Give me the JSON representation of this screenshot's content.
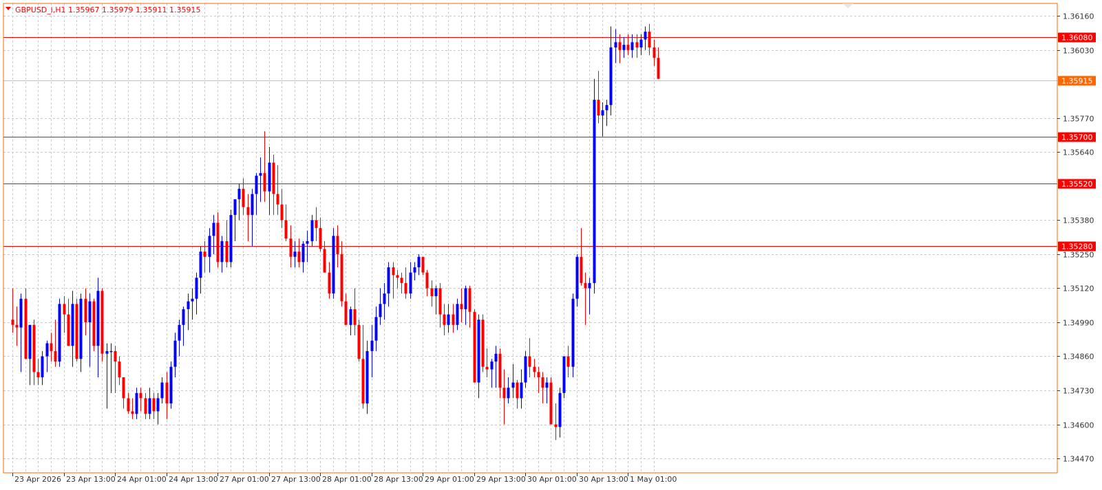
{
  "chart_data": {
    "type": "candlestick",
    "symbol": "GBPUSD_i,H1",
    "ohlc_header": {
      "open": "1.35967",
      "high": "1.35979",
      "low": "1.35911",
      "close": "1.35915"
    },
    "title": "GBPUSD_i,H1  1.35967 1.35979 1.35911 1.35915",
    "y_ticks": [
      "1.36160",
      "1.36030",
      "1.35770",
      "1.35640",
      "1.35380",
      "1.35250",
      "1.35120",
      "1.34990",
      "1.34860",
      "1.34730",
      "1.34600",
      "1.34470"
    ],
    "ylim": [
      1.34415,
      1.36208
    ],
    "x_ticks": [
      {
        "label": "23 Apr 2026",
        "bar": 0
      },
      {
        "label": "23 Apr 13:00",
        "bar": 12
      },
      {
        "label": "24 Apr 01:00",
        "bar": 24
      },
      {
        "label": "24 Apr 13:00",
        "bar": 36
      },
      {
        "label": "27 Apr 01:00",
        "bar": 48
      },
      {
        "label": "27 Apr 13:00",
        "bar": 60
      },
      {
        "label": "28 Apr 01:00",
        "bar": 72
      },
      {
        "label": "28 Apr 13:00",
        "bar": 84
      },
      {
        "label": "29 Apr 01:00",
        "bar": 96
      },
      {
        "label": "29 Apr 13:00",
        "bar": 108
      },
      {
        "label": "30 Apr 01:00",
        "bar": 120
      },
      {
        "label": "30 Apr 13:00",
        "bar": 132
      },
      {
        "label": "1 May 01:00",
        "bar": 144
      }
    ],
    "levels": [
      {
        "price": 1.3608,
        "label": "1.36080",
        "color": "#ff0000"
      },
      {
        "price": 1.357,
        "label": "1.35700",
        "color": "#ff0000"
      },
      {
        "price": 1.3552,
        "label": "1.35520",
        "color": "#ff0000"
      },
      {
        "price": 1.3528,
        "label": "1.35280",
        "color": "#ff0000"
      }
    ],
    "current_price": {
      "price": 1.35915,
      "label": "1.35915",
      "color": "#ff6600"
    },
    "bull_color": "#0000ff",
    "bear_color": "#ff0000",
    "candles": [
      [
        1.35,
        1.3512,
        1.3495,
        1.3498
      ],
      [
        1.3498,
        1.3505,
        1.349,
        1.3497
      ],
      [
        1.3497,
        1.351,
        1.348,
        1.3508
      ],
      [
        1.3508,
        1.3512,
        1.3485,
        1.3485
      ],
      [
        1.3485,
        1.3498,
        1.3475,
        1.3498
      ],
      [
        1.3498,
        1.35,
        1.3475,
        1.348
      ],
      [
        1.348,
        1.3485,
        1.3475,
        1.3478
      ],
      [
        1.3478,
        1.3488,
        1.3475,
        1.3486
      ],
      [
        1.3486,
        1.3492,
        1.348,
        1.3491
      ],
      [
        1.3491,
        1.3495,
        1.3484,
        1.3488
      ],
      [
        1.3488,
        1.35,
        1.3482,
        1.3484
      ],
      [
        1.3484,
        1.3508,
        1.3482,
        1.3506
      ],
      [
        1.3506,
        1.3509,
        1.3495,
        1.3502
      ],
      [
        1.3502,
        1.3508,
        1.349,
        1.349
      ],
      [
        1.349,
        1.3511,
        1.3482,
        1.3506
      ],
      [
        1.3506,
        1.3508,
        1.3484,
        1.3485
      ],
      [
        1.3485,
        1.351,
        1.348,
        1.3508
      ],
      [
        1.3508,
        1.3512,
        1.3494,
        1.3499
      ],
      [
        1.3499,
        1.351,
        1.3482,
        1.3507
      ],
      [
        1.3507,
        1.3508,
        1.3488,
        1.349
      ],
      [
        1.349,
        1.3516,
        1.3478,
        1.3511
      ],
      [
        1.3511,
        1.3512,
        1.3484,
        1.3487
      ],
      [
        1.3487,
        1.3491,
        1.3466,
        1.3488
      ],
      [
        1.3488,
        1.3491,
        1.3472,
        1.3488
      ],
      [
        1.3488,
        1.349,
        1.3472,
        1.3484
      ],
      [
        1.3484,
        1.3486,
        1.3475,
        1.3478
      ],
      [
        1.3478,
        1.3478,
        1.3466,
        1.347
      ],
      [
        1.347,
        1.3472,
        1.3464,
        1.3465
      ],
      [
        1.3465,
        1.347,
        1.3462,
        1.3464
      ],
      [
        1.3464,
        1.3474,
        1.3462,
        1.3472
      ],
      [
        1.3472,
        1.3474,
        1.3465,
        1.347
      ],
      [
        1.347,
        1.3472,
        1.3462,
        1.3464
      ],
      [
        1.3464,
        1.3474,
        1.3462,
        1.347
      ],
      [
        1.347,
        1.3472,
        1.3462,
        1.3465
      ],
      [
        1.3465,
        1.3472,
        1.346,
        1.347
      ],
      [
        1.347,
        1.3478,
        1.3468,
        1.3476
      ],
      [
        1.3476,
        1.348,
        1.3462,
        1.3468
      ],
      [
        1.3468,
        1.3484,
        1.3466,
        1.3482
      ],
      [
        1.3482,
        1.3495,
        1.3478,
        1.3492
      ],
      [
        1.3492,
        1.35,
        1.3486,
        1.3498
      ],
      [
        1.3498,
        1.3505,
        1.349,
        1.3504
      ],
      [
        1.3504,
        1.351,
        1.3496,
        1.3507
      ],
      [
        1.3507,
        1.3512,
        1.35,
        1.3508
      ],
      [
        1.3508,
        1.3518,
        1.3502,
        1.3516
      ],
      [
        1.3516,
        1.3528,
        1.351,
        1.3526
      ],
      [
        1.3526,
        1.353,
        1.3518,
        1.3524
      ],
      [
        1.3524,
        1.3535,
        1.3518,
        1.3532
      ],
      [
        1.3532,
        1.354,
        1.3525,
        1.3537
      ],
      [
        1.3537,
        1.3541,
        1.352,
        1.3522
      ],
      [
        1.3522,
        1.3532,
        1.3518,
        1.353
      ],
      [
        1.353,
        1.3538,
        1.352,
        1.3522
      ],
      [
        1.3522,
        1.3542,
        1.352,
        1.354
      ],
      [
        1.354,
        1.3545,
        1.353,
        1.3546
      ],
      [
        1.3546,
        1.3552,
        1.3538,
        1.355
      ],
      [
        1.355,
        1.3554,
        1.354,
        1.3543
      ],
      [
        1.3543,
        1.3548,
        1.353,
        1.354
      ],
      [
        1.354,
        1.355,
        1.3528,
        1.3548
      ],
      [
        1.3548,
        1.3556,
        1.354,
        1.3555
      ],
      [
        1.3555,
        1.3562,
        1.3545,
        1.3556
      ],
      [
        1.3556,
        1.3572,
        1.3545,
        1.3549
      ],
      [
        1.3549,
        1.3566,
        1.354,
        1.356
      ],
      [
        1.356,
        1.3563,
        1.354,
        1.3548
      ],
      [
        1.3548,
        1.3559,
        1.354,
        1.3544
      ],
      [
        1.3544,
        1.355,
        1.3535,
        1.3538
      ],
      [
        1.3538,
        1.3544,
        1.353,
        1.3531
      ],
      [
        1.3531,
        1.3536,
        1.352,
        1.3524
      ],
      [
        1.3524,
        1.353,
        1.352,
        1.3526
      ],
      [
        1.3526,
        1.3531,
        1.352,
        1.3522
      ],
      [
        1.3522,
        1.353,
        1.3518,
        1.3529
      ],
      [
        1.3529,
        1.3534,
        1.3522,
        1.353
      ],
      [
        1.353,
        1.354,
        1.3528,
        1.3538
      ],
      [
        1.3538,
        1.3543,
        1.353,
        1.3535
      ],
      [
        1.3535,
        1.3539,
        1.3526,
        1.3527
      ],
      [
        1.3527,
        1.353,
        1.3518,
        1.3518
      ],
      [
        1.3518,
        1.3522,
        1.3508,
        1.351
      ],
      [
        1.351,
        1.3535,
        1.3508,
        1.3532
      ],
      [
        1.3532,
        1.3536,
        1.352,
        1.3525
      ],
      [
        1.3525,
        1.353,
        1.3505,
        1.3507
      ],
      [
        1.3507,
        1.351,
        1.3498,
        1.3498
      ],
      [
        1.3498,
        1.3505,
        1.3494,
        1.3504
      ],
      [
        1.3504,
        1.3512,
        1.3494,
        1.3498
      ],
      [
        1.3498,
        1.35,
        1.3484,
        1.3485
      ],
      [
        1.3485,
        1.3498,
        1.3466,
        1.3468
      ],
      [
        1.3468,
        1.3492,
        1.3464,
        1.3488
      ],
      [
        1.3488,
        1.3498,
        1.3478,
        1.3492
      ],
      [
        1.3492,
        1.3505,
        1.3488,
        1.3501
      ],
      [
        1.3501,
        1.3512,
        1.3498,
        1.3506
      ],
      [
        1.3506,
        1.3514,
        1.35,
        1.351
      ],
      [
        1.351,
        1.3522,
        1.3505,
        1.352
      ],
      [
        1.352,
        1.3522,
        1.3508,
        1.3517
      ],
      [
        1.3517,
        1.3519,
        1.3512,
        1.3516
      ],
      [
        1.3516,
        1.3518,
        1.351,
        1.3514
      ],
      [
        1.3514,
        1.352,
        1.3508,
        1.351
      ],
      [
        1.351,
        1.3522,
        1.3508,
        1.3518
      ],
      [
        1.3518,
        1.3522,
        1.3515,
        1.352
      ],
      [
        1.352,
        1.3525,
        1.3517,
        1.3524
      ],
      [
        1.3524,
        1.3522,
        1.3517,
        1.3518
      ],
      [
        1.3518,
        1.3519,
        1.3509,
        1.3512
      ],
      [
        1.3512,
        1.3515,
        1.3505,
        1.3509
      ],
      [
        1.3509,
        1.3513,
        1.3502,
        1.3512
      ],
      [
        1.3512,
        1.3514,
        1.3497,
        1.3502
      ],
      [
        1.3502,
        1.3506,
        1.3494,
        1.3498
      ],
      [
        1.3498,
        1.3506,
        1.3495,
        1.3502
      ],
      [
        1.3502,
        1.3506,
        1.3495,
        1.3498
      ],
      [
        1.3498,
        1.3508,
        1.3496,
        1.3506
      ],
      [
        1.3506,
        1.3512,
        1.3499,
        1.3504
      ],
      [
        1.3504,
        1.3513,
        1.3498,
        1.3512
      ],
      [
        1.3512,
        1.3513,
        1.3497,
        1.3503
      ],
      [
        1.3503,
        1.3504,
        1.3476,
        1.3476
      ],
      [
        1.3476,
        1.3502,
        1.347,
        1.35
      ],
      [
        1.35,
        1.3502,
        1.348,
        1.3482
      ],
      [
        1.3482,
        1.3489,
        1.3478,
        1.3481
      ],
      [
        1.3481,
        1.3485,
        1.3474,
        1.3484
      ],
      [
        1.3484,
        1.349,
        1.3474,
        1.3487
      ],
      [
        1.3487,
        1.3489,
        1.347,
        1.3474
      ],
      [
        1.3474,
        1.3481,
        1.346,
        1.347
      ],
      [
        1.347,
        1.3478,
        1.3468,
        1.3474
      ],
      [
        1.3474,
        1.3483,
        1.347,
        1.3476
      ],
      [
        1.3476,
        1.3477,
        1.3466,
        1.347
      ],
      [
        1.347,
        1.3481,
        1.3466,
        1.3476
      ],
      [
        1.3476,
        1.3488,
        1.3474,
        1.3486
      ],
      [
        1.3486,
        1.3493,
        1.3478,
        1.3482
      ],
      [
        1.3482,
        1.3485,
        1.3478,
        1.348
      ],
      [
        1.348,
        1.3482,
        1.3472,
        1.3478
      ],
      [
        1.3478,
        1.348,
        1.3468,
        1.3474
      ],
      [
        1.3474,
        1.3478,
        1.3468,
        1.3476
      ],
      [
        1.3476,
        1.3478,
        1.346,
        1.346
      ],
      [
        1.346,
        1.3468,
        1.3454,
        1.3459
      ],
      [
        1.3459,
        1.3474,
        1.3455,
        1.3472
      ],
      [
        1.3472,
        1.3486,
        1.347,
        1.3486
      ],
      [
        1.3486,
        1.349,
        1.3478,
        1.3482
      ],
      [
        1.3482,
        1.351,
        1.3478,
        1.3508
      ],
      [
        1.3508,
        1.3525,
        1.3505,
        1.3524
      ],
      [
        1.3524,
        1.3535,
        1.3513,
        1.3514
      ],
      [
        1.3514,
        1.3518,
        1.3498,
        1.3512
      ],
      [
        1.3512,
        1.3516,
        1.3502,
        1.3514
      ],
      [
        1.3514,
        1.3592,
        1.351,
        1.3584
      ],
      [
        1.3584,
        1.3595,
        1.3575,
        1.3578
      ],
      [
        1.3578,
        1.3583,
        1.357,
        1.358
      ],
      [
        1.358,
        1.3584,
        1.3574,
        1.3582
      ],
      [
        1.3582,
        1.3612,
        1.3578,
        1.3604
      ],
      [
        1.3604,
        1.3611,
        1.3598,
        1.3606
      ],
      [
        1.3606,
        1.3609,
        1.3598,
        1.3603
      ],
      [
        1.3603,
        1.3608,
        1.36,
        1.3605
      ],
      [
        1.3605,
        1.3609,
        1.3601,
        1.3603
      ],
      [
        1.3603,
        1.3609,
        1.36,
        1.3606
      ],
      [
        1.3606,
        1.3609,
        1.36,
        1.3604
      ],
      [
        1.3604,
        1.3609,
        1.3601,
        1.3607
      ],
      [
        1.3607,
        1.3612,
        1.3603,
        1.361
      ],
      [
        1.361,
        1.3613,
        1.3601,
        1.3604
      ],
      [
        1.3604,
        1.3607,
        1.3597,
        1.36
      ],
      [
        1.36,
        1.3604,
        1.3592,
        1.3592
      ]
    ]
  }
}
